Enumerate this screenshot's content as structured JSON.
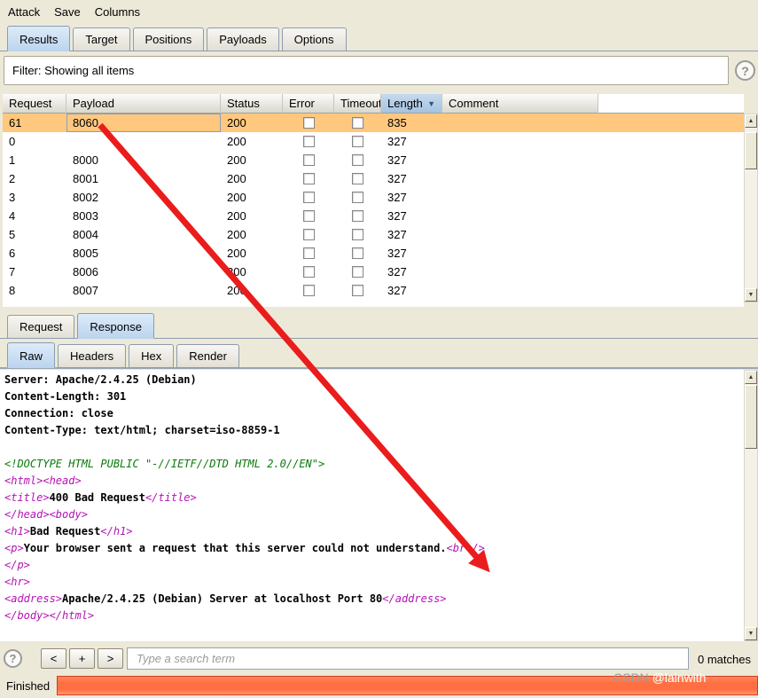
{
  "colors": {
    "selected_row": "#ffc87e",
    "progress": "#ff6f42",
    "tag": "#b512b5",
    "doctype": "#0a7a0a",
    "arrow": "#ea1c1c"
  },
  "icons": {
    "help": "?",
    "scroll_up": "▲",
    "scroll_down": "▼"
  },
  "menubar": {
    "items": [
      "Attack",
      "Save",
      "Columns"
    ]
  },
  "main_tabs": {
    "selected": "Results",
    "items": [
      "Results",
      "Target",
      "Positions",
      "Payloads",
      "Options"
    ]
  },
  "filter": {
    "text": "Filter: Showing all items"
  },
  "results_table": {
    "columns": [
      "Request",
      "Payload",
      "Status",
      "Error",
      "Timeout",
      "Length",
      "Comment"
    ],
    "sort_column": "Length",
    "sort_indicator": "▼",
    "rows": [
      {
        "request": "61",
        "payload": "8060",
        "status": "200",
        "error": false,
        "timeout": false,
        "length": "835",
        "comment": "",
        "selected": true
      },
      {
        "request": "0",
        "payload": "",
        "status": "200",
        "error": false,
        "timeout": false,
        "length": "327",
        "comment": "",
        "selected": false
      },
      {
        "request": "1",
        "payload": "8000",
        "status": "200",
        "error": false,
        "timeout": false,
        "length": "327",
        "comment": "",
        "selected": false
      },
      {
        "request": "2",
        "payload": "8001",
        "status": "200",
        "error": false,
        "timeout": false,
        "length": "327",
        "comment": "",
        "selected": false
      },
      {
        "request": "3",
        "payload": "8002",
        "status": "200",
        "error": false,
        "timeout": false,
        "length": "327",
        "comment": "",
        "selected": false
      },
      {
        "request": "4",
        "payload": "8003",
        "status": "200",
        "error": false,
        "timeout": false,
        "length": "327",
        "comment": "",
        "selected": false
      },
      {
        "request": "5",
        "payload": "8004",
        "status": "200",
        "error": false,
        "timeout": false,
        "length": "327",
        "comment": "",
        "selected": false
      },
      {
        "request": "6",
        "payload": "8005",
        "status": "200",
        "error": false,
        "timeout": false,
        "length": "327",
        "comment": "",
        "selected": false
      },
      {
        "request": "7",
        "payload": "8006",
        "status": "200",
        "error": false,
        "timeout": false,
        "length": "327",
        "comment": "",
        "selected": false
      },
      {
        "request": "8",
        "payload": "8007",
        "status": "200",
        "error": false,
        "timeout": false,
        "length": "327",
        "comment": "",
        "selected": false
      }
    ]
  },
  "message_tabs": {
    "selected": "Response",
    "items": [
      "Request",
      "Response"
    ]
  },
  "view_tabs": {
    "selected": "Raw",
    "items": [
      "Raw",
      "Headers",
      "Hex",
      "Render"
    ]
  },
  "response_viewer": {
    "lines": [
      [
        {
          "t": "text",
          "s": "Server: Apache/2.4.25 (Debian)"
        }
      ],
      [
        {
          "t": "text",
          "s": "Content-Length: 301"
        }
      ],
      [
        {
          "t": "text",
          "s": "Connection: close"
        }
      ],
      [
        {
          "t": "text",
          "s": "Content-Type: text/html; charset=iso-8859-1"
        }
      ],
      [],
      [
        {
          "t": "doctype",
          "s": "<!DOCTYPE HTML PUBLIC \"-//IETF//DTD HTML 2.0//EN\">"
        }
      ],
      [
        {
          "t": "tag",
          "s": "<html>"
        },
        {
          "t": "tag",
          "s": "<head>"
        }
      ],
      [
        {
          "t": "tag",
          "s": "<title>"
        },
        {
          "t": "text",
          "s": "400 Bad Request"
        },
        {
          "t": "tag",
          "s": "</title>"
        }
      ],
      [
        {
          "t": "tag",
          "s": "</head>"
        },
        {
          "t": "tag",
          "s": "<body>"
        }
      ],
      [
        {
          "t": "tag",
          "s": "<h1>"
        },
        {
          "t": "text",
          "s": "Bad Request"
        },
        {
          "t": "tag",
          "s": "</h1>"
        }
      ],
      [
        {
          "t": "tag",
          "s": "<p>"
        },
        {
          "t": "text",
          "s": "Your browser sent a request that this server could not understand."
        },
        {
          "t": "tag",
          "s": "<br />"
        }
      ],
      [
        {
          "t": "tag",
          "s": "</p>"
        }
      ],
      [
        {
          "t": "tag",
          "s": "<hr>"
        }
      ],
      [
        {
          "t": "tag",
          "s": "<address>"
        },
        {
          "t": "text",
          "s": "Apache/2.4.25 (Debian) Server at localhost Port 80"
        },
        {
          "t": "tag",
          "s": "</address>"
        }
      ],
      [
        {
          "t": "tag",
          "s": "</body>"
        },
        {
          "t": "tag",
          "s": "</html>"
        }
      ]
    ]
  },
  "search_bar": {
    "prev_label": "<",
    "add_label": "+",
    "next_label": ">",
    "placeholder": "Type a search term",
    "matches": "0 matches"
  },
  "status_bar": {
    "label": "Finished"
  },
  "watermark": {
    "prefix": "CSDN ",
    "handle": "@lainwith"
  }
}
